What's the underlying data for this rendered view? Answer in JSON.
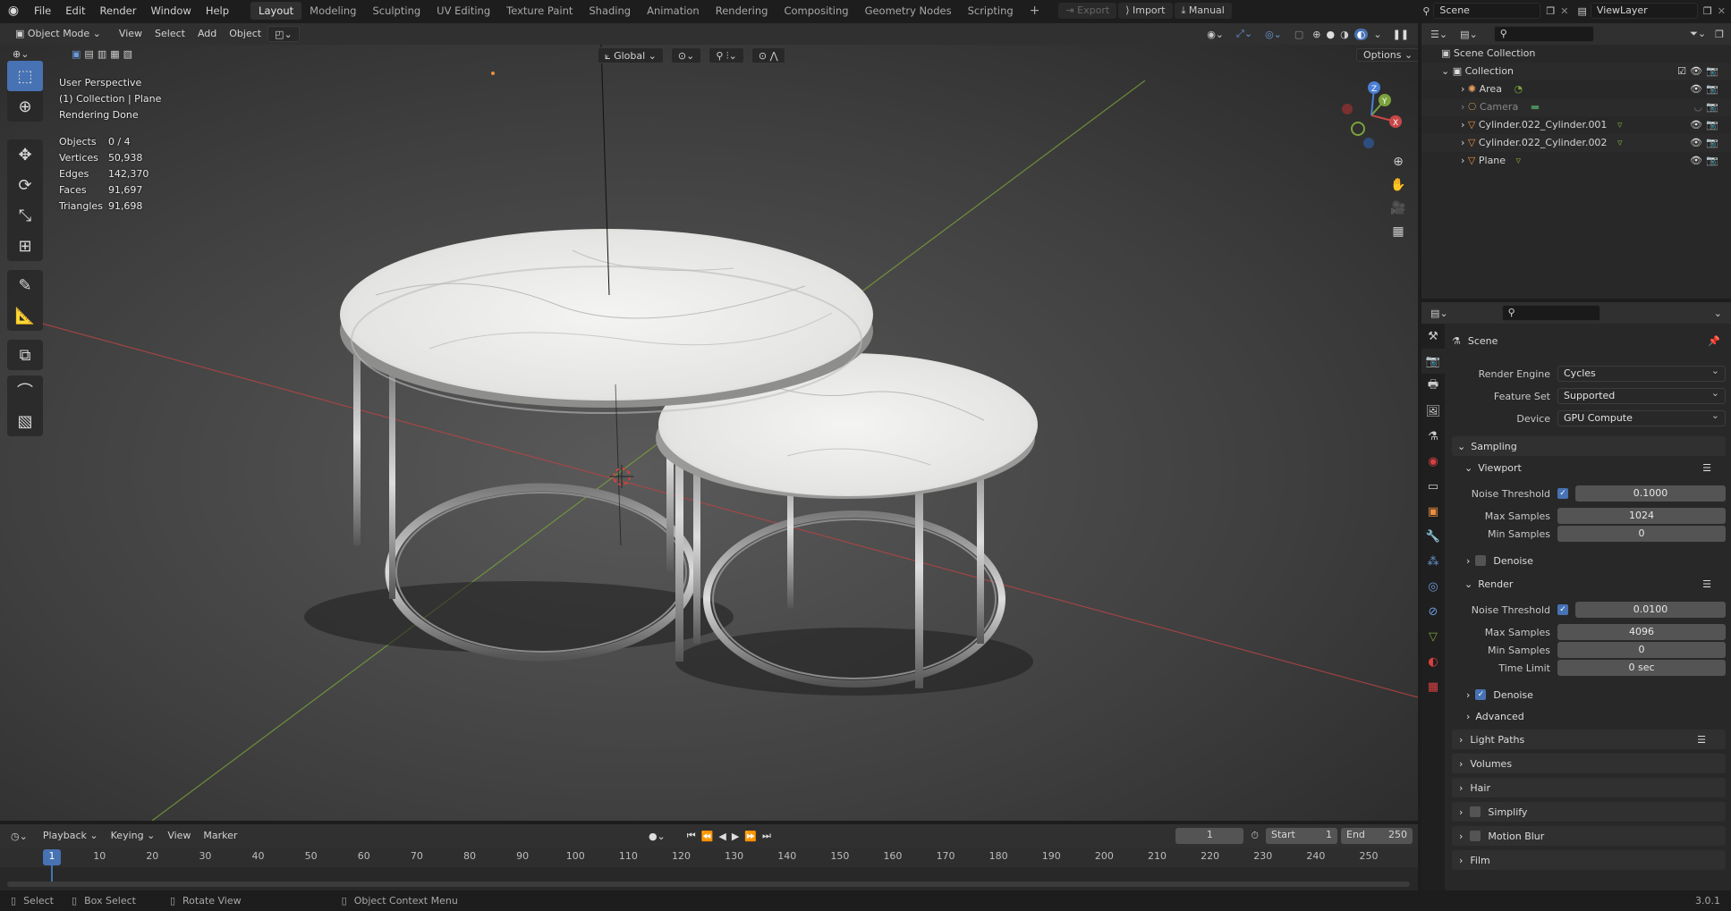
{
  "topbar": {
    "menus": [
      "File",
      "Edit",
      "Render",
      "Window",
      "Help"
    ],
    "workspaces": [
      "Layout",
      "Modeling",
      "Sculpting",
      "UV Editing",
      "Texture Paint",
      "Shading",
      "Animation",
      "Rendering",
      "Compositing",
      "Geometry Nodes",
      "Scripting"
    ],
    "active_workspace": "Layout",
    "export_label": "Export",
    "import_label": "Import",
    "manual_label": "Manual",
    "scene_name": "Scene",
    "view_layer": "ViewLayer"
  },
  "viewport_header": {
    "mode": "Object Mode",
    "menus": [
      "View",
      "Select",
      "Add",
      "Object"
    ],
    "transform_orientation": "Global",
    "options_label": "Options"
  },
  "viewport_overlay": {
    "perspective": "User Perspective",
    "collection_info": "(1) Collection | Plane",
    "render_status": "Rendering Done",
    "stats": [
      {
        "label": "Objects",
        "value": "0 / 4"
      },
      {
        "label": "Vertices",
        "value": "50,938"
      },
      {
        "label": "Edges",
        "value": "142,370"
      },
      {
        "label": "Faces",
        "value": "91,697"
      },
      {
        "label": "Triangles",
        "value": "91,698"
      }
    ]
  },
  "timeline": {
    "menus": [
      "Playback",
      "Keying",
      "View",
      "Marker"
    ],
    "current_frame": "1",
    "start_label": "Start",
    "start": "1",
    "end_label": "End",
    "end": "250",
    "frames": [
      "1",
      "10",
      "20",
      "30",
      "40",
      "50",
      "60",
      "70",
      "80",
      "90",
      "100",
      "110",
      "120",
      "130",
      "140",
      "150",
      "160",
      "170",
      "180",
      "190",
      "200",
      "210",
      "220",
      "230",
      "240",
      "250"
    ]
  },
  "outliner": {
    "root": "Scene Collection",
    "collection": "Collection",
    "items": [
      {
        "name": "Area",
        "color": "#e8a060"
      },
      {
        "name": "Camera",
        "color": "#a88050"
      },
      {
        "name": "Cylinder.022_Cylinder.001",
        "color": "#e89040"
      },
      {
        "name": "Cylinder.022_Cylinder.002",
        "color": "#e89040"
      },
      {
        "name": "Plane",
        "color": "#e89040"
      }
    ]
  },
  "properties": {
    "context": "Scene",
    "render_engine_label": "Render Engine",
    "render_engine": "Cycles",
    "feature_set_label": "Feature Set",
    "feature_set": "Supported",
    "device_label": "Device",
    "device": "GPU Compute",
    "sampling": "Sampling",
    "viewport": "Viewport",
    "noise_threshold_label": "Noise Threshold",
    "viewport_noise_threshold": "0.1000",
    "max_samples_label": "Max Samples",
    "viewport_max_samples": "1024",
    "min_samples_label": "Min Samples",
    "viewport_min_samples": "0",
    "denoise_label": "Denoise",
    "render": "Render",
    "render_noise_threshold": "0.0100",
    "render_max_samples": "4096",
    "render_min_samples": "0",
    "time_limit_label": "Time Limit",
    "time_limit": "0 sec",
    "advanced": "Advanced",
    "sections": [
      "Light Paths",
      "Volumes",
      "Hair",
      "Simplify",
      "Motion Blur",
      "Film"
    ]
  },
  "statusbar": {
    "select": "Select",
    "box_select": "Box Select",
    "rotate_view": "Rotate View",
    "context_menu": "Object Context Menu",
    "version": "3.0.1"
  },
  "colors": {
    "accent": "#4772b3",
    "x_axis": "#c84848",
    "y_axis": "#7ba23c",
    "z_axis": "#4b7fd4"
  }
}
